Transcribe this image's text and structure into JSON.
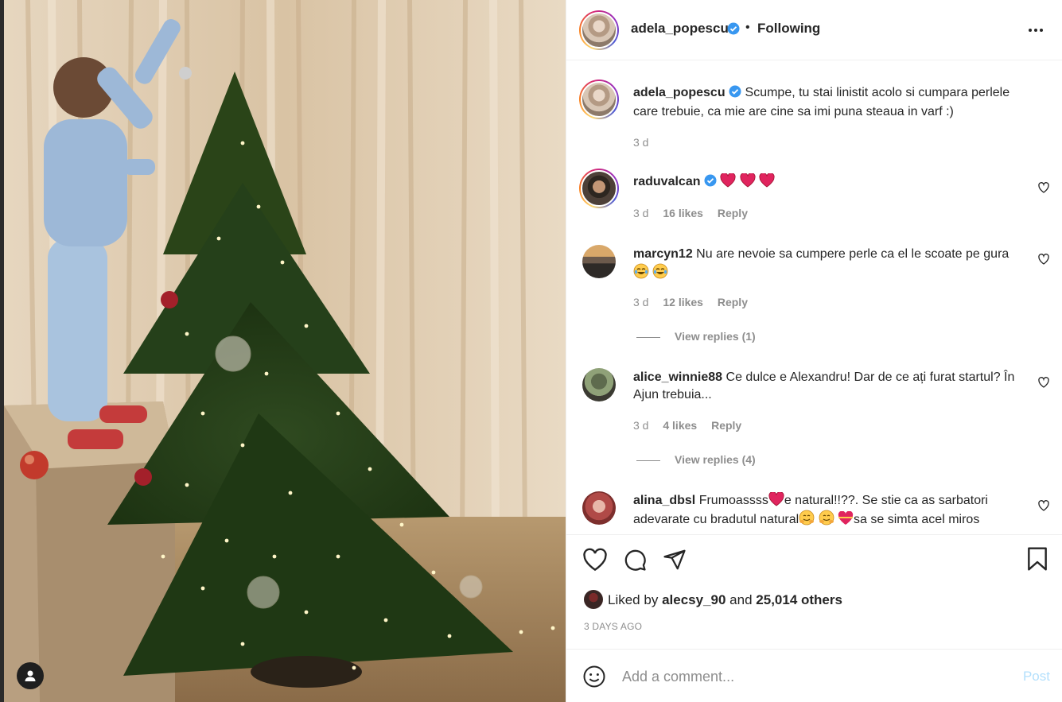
{
  "post": {
    "author": "adela_popescu",
    "separator": "•",
    "follow_status": "Following",
    "more_icon": "more-horizontal-icon",
    "photo_alt": "photo-christmas-tree"
  },
  "caption": {
    "username": "adela_popescu",
    "text": "Scumpe, tu stai linistit acolo si cumpara perlele care trebuie, ca mie are cine sa imi puna steaua in varf :)",
    "time": "3 d"
  },
  "comments": [
    {
      "username": "raduvalcan",
      "verified": true,
      "text": "",
      "emoji": [
        "heart",
        "heart",
        "heart"
      ],
      "time": "3 d",
      "likes": "16 likes",
      "reply": "Reply"
    },
    {
      "username": "marcyn12",
      "text": "Nu are nevoie sa cumpere perle ca el le scoate pe gura",
      "emoji": [
        "laughing",
        "laughing"
      ],
      "time": "3 d",
      "likes": "12 likes",
      "reply": "Reply",
      "view_replies": "View replies (1)"
    },
    {
      "username": "alice_winnie88",
      "text": "Ce dulce e Alexandru! Dar de ce ați furat startul? În Ajun trebuia...",
      "time": "3 d",
      "likes": "4 likes",
      "reply": "Reply",
      "view_replies": "View replies (4)"
    },
    {
      "username": "alina_dbsl",
      "text_a": "Frumoassss",
      "text_b": "e natural!!??. Se stie ca as sarbatori adevarate cu bradutul natural",
      "text_c": "sa se simta acel miros"
    }
  ],
  "likes": {
    "prefix": "Liked by",
    "user": "alecsy_90",
    "middle": "and",
    "count": "25,014 others"
  },
  "date": "3 DAYS AGO",
  "add_comment": {
    "placeholder": "Add a comment...",
    "post_label": "Post"
  },
  "colors": {
    "text": "#262626",
    "muted": "#8e8e8e",
    "verified": "#3897f0",
    "post_disabled": "#b2dffc",
    "heart_emoji": "#e0245e"
  }
}
